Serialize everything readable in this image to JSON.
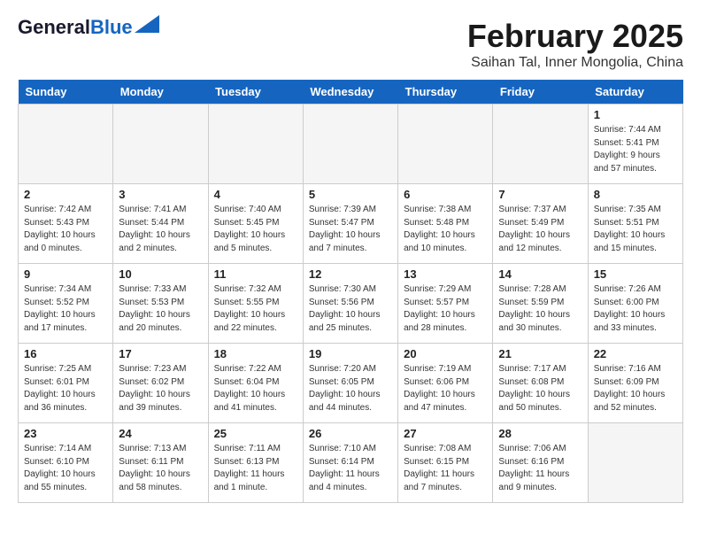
{
  "header": {
    "logo_general": "General",
    "logo_blue": "Blue",
    "month_title": "February 2025",
    "subtitle": "Saihan Tal, Inner Mongolia, China"
  },
  "days_of_week": [
    "Sunday",
    "Monday",
    "Tuesday",
    "Wednesday",
    "Thursday",
    "Friday",
    "Saturday"
  ],
  "weeks": [
    [
      {
        "day": "",
        "info": ""
      },
      {
        "day": "",
        "info": ""
      },
      {
        "day": "",
        "info": ""
      },
      {
        "day": "",
        "info": ""
      },
      {
        "day": "",
        "info": ""
      },
      {
        "day": "",
        "info": ""
      },
      {
        "day": "1",
        "info": "Sunrise: 7:44 AM\nSunset: 5:41 PM\nDaylight: 9 hours and 57 minutes."
      }
    ],
    [
      {
        "day": "2",
        "info": "Sunrise: 7:42 AM\nSunset: 5:43 PM\nDaylight: 10 hours and 0 minutes."
      },
      {
        "day": "3",
        "info": "Sunrise: 7:41 AM\nSunset: 5:44 PM\nDaylight: 10 hours and 2 minutes."
      },
      {
        "day": "4",
        "info": "Sunrise: 7:40 AM\nSunset: 5:45 PM\nDaylight: 10 hours and 5 minutes."
      },
      {
        "day": "5",
        "info": "Sunrise: 7:39 AM\nSunset: 5:47 PM\nDaylight: 10 hours and 7 minutes."
      },
      {
        "day": "6",
        "info": "Sunrise: 7:38 AM\nSunset: 5:48 PM\nDaylight: 10 hours and 10 minutes."
      },
      {
        "day": "7",
        "info": "Sunrise: 7:37 AM\nSunset: 5:49 PM\nDaylight: 10 hours and 12 minutes."
      },
      {
        "day": "8",
        "info": "Sunrise: 7:35 AM\nSunset: 5:51 PM\nDaylight: 10 hours and 15 minutes."
      }
    ],
    [
      {
        "day": "9",
        "info": "Sunrise: 7:34 AM\nSunset: 5:52 PM\nDaylight: 10 hours and 17 minutes."
      },
      {
        "day": "10",
        "info": "Sunrise: 7:33 AM\nSunset: 5:53 PM\nDaylight: 10 hours and 20 minutes."
      },
      {
        "day": "11",
        "info": "Sunrise: 7:32 AM\nSunset: 5:55 PM\nDaylight: 10 hours and 22 minutes."
      },
      {
        "day": "12",
        "info": "Sunrise: 7:30 AM\nSunset: 5:56 PM\nDaylight: 10 hours and 25 minutes."
      },
      {
        "day": "13",
        "info": "Sunrise: 7:29 AM\nSunset: 5:57 PM\nDaylight: 10 hours and 28 minutes."
      },
      {
        "day": "14",
        "info": "Sunrise: 7:28 AM\nSunset: 5:59 PM\nDaylight: 10 hours and 30 minutes."
      },
      {
        "day": "15",
        "info": "Sunrise: 7:26 AM\nSunset: 6:00 PM\nDaylight: 10 hours and 33 minutes."
      }
    ],
    [
      {
        "day": "16",
        "info": "Sunrise: 7:25 AM\nSunset: 6:01 PM\nDaylight: 10 hours and 36 minutes."
      },
      {
        "day": "17",
        "info": "Sunrise: 7:23 AM\nSunset: 6:02 PM\nDaylight: 10 hours and 39 minutes."
      },
      {
        "day": "18",
        "info": "Sunrise: 7:22 AM\nSunset: 6:04 PM\nDaylight: 10 hours and 41 minutes."
      },
      {
        "day": "19",
        "info": "Sunrise: 7:20 AM\nSunset: 6:05 PM\nDaylight: 10 hours and 44 minutes."
      },
      {
        "day": "20",
        "info": "Sunrise: 7:19 AM\nSunset: 6:06 PM\nDaylight: 10 hours and 47 minutes."
      },
      {
        "day": "21",
        "info": "Sunrise: 7:17 AM\nSunset: 6:08 PM\nDaylight: 10 hours and 50 minutes."
      },
      {
        "day": "22",
        "info": "Sunrise: 7:16 AM\nSunset: 6:09 PM\nDaylight: 10 hours and 52 minutes."
      }
    ],
    [
      {
        "day": "23",
        "info": "Sunrise: 7:14 AM\nSunset: 6:10 PM\nDaylight: 10 hours and 55 minutes."
      },
      {
        "day": "24",
        "info": "Sunrise: 7:13 AM\nSunset: 6:11 PM\nDaylight: 10 hours and 58 minutes."
      },
      {
        "day": "25",
        "info": "Sunrise: 7:11 AM\nSunset: 6:13 PM\nDaylight: 11 hours and 1 minute."
      },
      {
        "day": "26",
        "info": "Sunrise: 7:10 AM\nSunset: 6:14 PM\nDaylight: 11 hours and 4 minutes."
      },
      {
        "day": "27",
        "info": "Sunrise: 7:08 AM\nSunset: 6:15 PM\nDaylight: 11 hours and 7 minutes."
      },
      {
        "day": "28",
        "info": "Sunrise: 7:06 AM\nSunset: 6:16 PM\nDaylight: 11 hours and 9 minutes."
      },
      {
        "day": "",
        "info": ""
      }
    ]
  ]
}
